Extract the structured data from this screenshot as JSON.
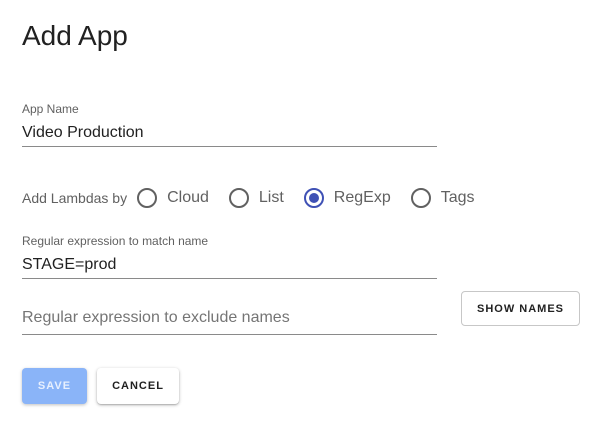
{
  "page": {
    "title": "Add App"
  },
  "app_name": {
    "label": "App Name",
    "value": "Video Production"
  },
  "lambdas": {
    "label": "Add Lambdas by",
    "options": [
      {
        "label": "Cloud",
        "checked": false
      },
      {
        "label": "List",
        "checked": false
      },
      {
        "label": "RegExp",
        "checked": true
      },
      {
        "label": "Tags",
        "checked": false
      }
    ]
  },
  "regexp_match": {
    "label": "Regular expression to match name",
    "value": "STAGE=prod"
  },
  "regexp_exclude": {
    "placeholder": "Regular expression to exclude names",
    "value": ""
  },
  "actions": {
    "show_names_label": "Show Names",
    "save_label": "Save",
    "cancel_label": "Cancel"
  },
  "colors": {
    "accent": "#3f51b5",
    "save_disabled_bg": "#8ab4f8"
  }
}
